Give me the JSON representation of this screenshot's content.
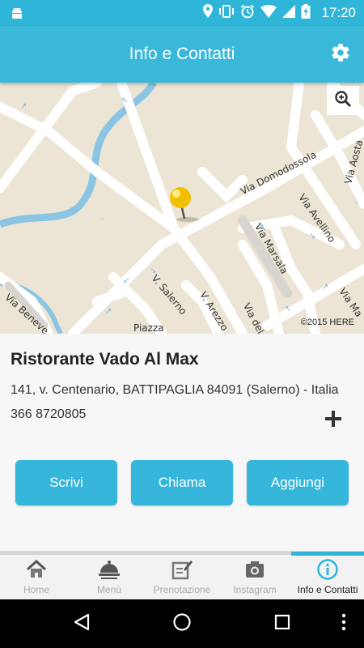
{
  "status_bar": {
    "time": "17:20"
  },
  "app_bar": {
    "title": "Info e Contatti"
  },
  "map": {
    "streets": [
      "Via Domodossola",
      "Via Avellino",
      "Via Marsala",
      "V. Salerno",
      "V. Arezzo",
      "Via del Ce",
      "Via Beneve",
      "Piazza",
      "Via Aosta",
      "Via Ma"
    ],
    "copyright": "©2015 HERE"
  },
  "restaurant": {
    "name": "Ristorante Vado Al Max",
    "address": "141, v. Centenario, BATTIPAGLIA 84091 (Salerno) - Italia",
    "phone": "366 8720805"
  },
  "actions": {
    "write": "Scrivi",
    "call": "Chiama",
    "add": "Aggiungi"
  },
  "tabs": [
    {
      "label": "Home",
      "icon": "home-icon"
    },
    {
      "label": "Menù",
      "icon": "cloche-icon"
    },
    {
      "label": "Prenotazione",
      "icon": "reservation-icon"
    },
    {
      "label": "Instagram",
      "icon": "camera-icon"
    },
    {
      "label": "Info e Contatti",
      "icon": "info-icon"
    }
  ],
  "active_tab": "Info e Contatti",
  "colors": {
    "primary": "#39b8da",
    "status_bar": "#2fb5d8",
    "button": "#37b6db",
    "map_bg": "#ece5d5",
    "river": "#8cc5e3"
  }
}
